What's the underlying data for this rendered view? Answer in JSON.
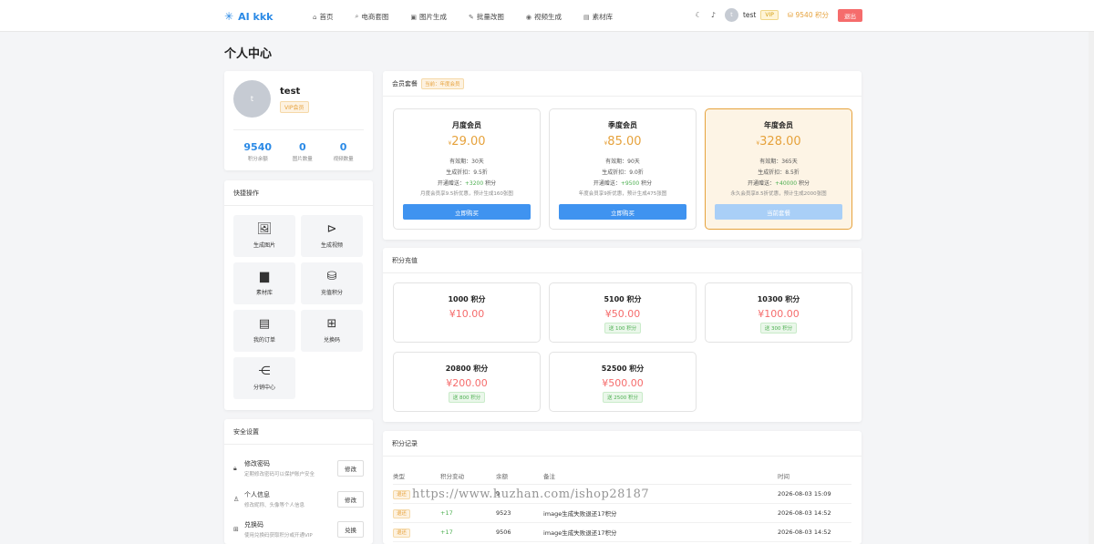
{
  "app": {
    "name": "AI kkk",
    "accent": "#2b8ae6"
  },
  "nav": {
    "items": [
      {
        "icon": "home-icon",
        "label": "首页"
      },
      {
        "icon": "search-icon",
        "label": "电商套图"
      },
      {
        "icon": "image-icon",
        "label": "图片生成"
      },
      {
        "icon": "magic-icon",
        "label": "批量改图"
      },
      {
        "icon": "video-icon",
        "label": "视频生成"
      },
      {
        "icon": "folder-icon",
        "label": "素材库"
      }
    ],
    "user_avatar": "t",
    "user_name": "test",
    "vip": "VIP",
    "points": "9540 积分",
    "logout": "退出"
  },
  "page": {
    "title": "个人中心"
  },
  "profile": {
    "avatar": "t",
    "name": "test",
    "vip": "VIP会员",
    "stats": [
      {
        "value": "9540",
        "label": "积分余额"
      },
      {
        "value": "0",
        "label": "图片数量"
      },
      {
        "value": "0",
        "label": "视频数量"
      }
    ]
  },
  "quick": {
    "title": "快捷操作",
    "items": [
      {
        "icon": "image-icon",
        "label": "生成图片"
      },
      {
        "icon": "play-icon",
        "label": "生成视频"
      },
      {
        "icon": "book-icon",
        "label": "素材库"
      },
      {
        "icon": "database-icon",
        "label": "充值积分"
      },
      {
        "icon": "document-icon",
        "label": "我的订单"
      },
      {
        "icon": "gift-icon",
        "label": "兑换码"
      },
      {
        "icon": "share-icon",
        "label": "分销中心"
      }
    ]
  },
  "security": {
    "title": "安全设置",
    "items": [
      {
        "icon": "lock-icon",
        "title": "修改密码",
        "desc": "定期修改密码可以保护账户安全",
        "button": "修改"
      },
      {
        "icon": "user-icon",
        "title": "个人信息",
        "desc": "修改昵称、头像等个人信息",
        "button": "修改"
      },
      {
        "icon": "gift-icon",
        "title": "兑换码",
        "desc": "使用兑换码获取积分或开通VIP",
        "button": "兑换"
      }
    ]
  },
  "membership": {
    "title": "会员套餐",
    "current": "当前：年度会员",
    "plans": [
      {
        "name": "月度会员",
        "currency": "¥",
        "price": "29.00",
        "validity": "有效期：30天",
        "discount": "生成折扣：9.5折",
        "bonus_prefix": "开通赠送：",
        "bonus": "+3200",
        "bonus_suffix": " 积分",
        "note": "月度会员享9.5折优惠，预计生成160张图",
        "button": "立即购买"
      },
      {
        "name": "季度会员",
        "currency": "¥",
        "price": "85.00",
        "validity": "有效期：90天",
        "discount": "生成折扣：9.0折",
        "bonus_prefix": "开通赠送：",
        "bonus": "+9500",
        "bonus_suffix": " 积分",
        "note": "年度会员享9折优惠，预计生成475张图",
        "button": "立即购买"
      },
      {
        "name": "年度会员",
        "currency": "¥",
        "price": "328.00",
        "validity": "有效期：365天",
        "discount": "生成折扣：8.5折",
        "bonus_prefix": "开通赠送：",
        "bonus": "+40000",
        "bonus_suffix": " 积分",
        "note": "永久会员享8.5折优惠，预计生成2000张图",
        "button": "当前套餐"
      }
    ]
  },
  "recharge": {
    "title": "积分充值",
    "items": [
      {
        "points": "1000 积分",
        "price": "¥10.00",
        "bonus": ""
      },
      {
        "points": "5100 积分",
        "price": "¥50.00",
        "bonus": "送 100 积分"
      },
      {
        "points": "10300 积分",
        "price": "¥100.00",
        "bonus": "送 300 积分"
      },
      {
        "points": "20800 积分",
        "price": "¥200.00",
        "bonus": "送 800 积分"
      },
      {
        "points": "52500 积分",
        "price": "¥500.00",
        "bonus": "送 2500 积分"
      }
    ]
  },
  "records": {
    "title": "积分记录",
    "columns": [
      "类型",
      "积分变动",
      "余额",
      "备注",
      "时间"
    ],
    "rows": [
      {
        "type": "退还",
        "change": "",
        "balance": "9",
        "note": "",
        "time": "2026-08-03 15:09"
      },
      {
        "type": "退还",
        "change": "+17",
        "balance": "9523",
        "note": "image生成失败退还17积分",
        "time": "2026-08-03 14:52"
      },
      {
        "type": "退还",
        "change": "+17",
        "balance": "9506",
        "note": "image生成失败退还17积分",
        "time": "2026-08-03 14:52"
      }
    ]
  },
  "watermark": "https://www.huzhan.com/ishop28187"
}
